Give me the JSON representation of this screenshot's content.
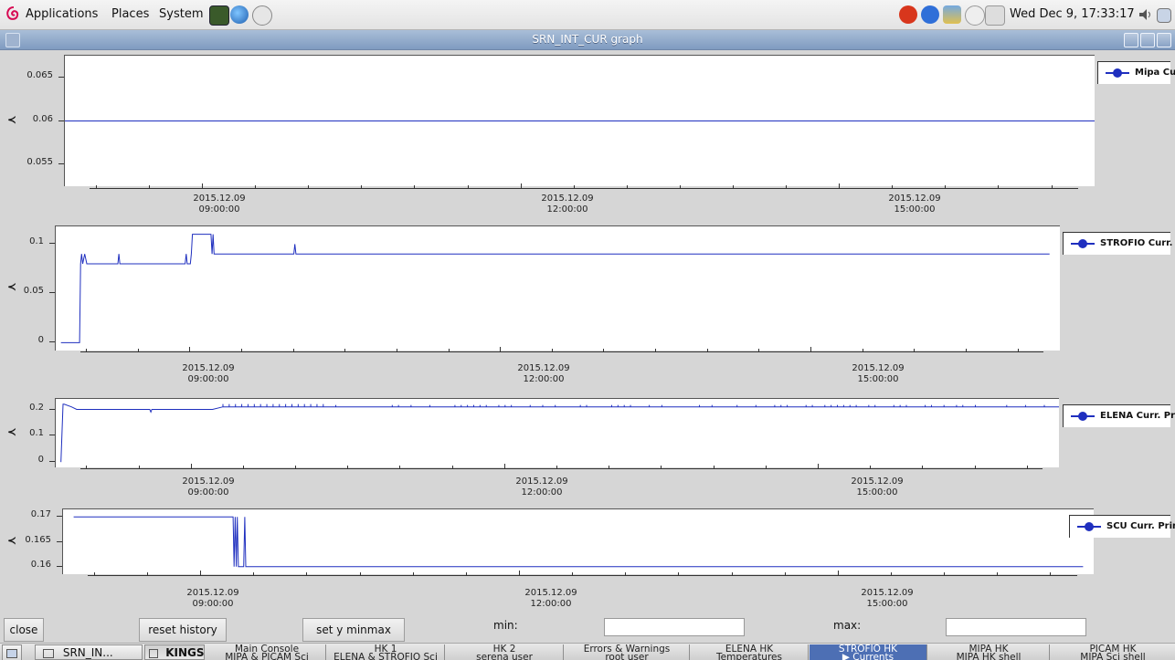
{
  "top_panel": {
    "applications": "Applications",
    "places": "Places",
    "system": "System",
    "clock": "Wed Dec  9, 17:33:17"
  },
  "window": {
    "title": "SRN_INT_CUR graph"
  },
  "colors": {
    "series": "#1f2fbf",
    "titlebar": "#8aa3c6",
    "active_workspace": "#4d6fb4"
  },
  "chart_data": [
    {
      "type": "line",
      "title": "",
      "ylabel": "A",
      "x_tick_labels": [
        {
          "date": "2015.12.09",
          "time": "09:00:00"
        },
        {
          "date": "2015.12.09",
          "time": "12:00:00"
        },
        {
          "date": "2015.12.09",
          "time": "15:00:00"
        }
      ],
      "x_hours": [
        7.7,
        17.4
      ],
      "ylim": [
        0.0525,
        0.0675
      ],
      "y_ticks": [
        "0.065",
        "0.06",
        "0.055"
      ],
      "y_tick_values": [
        0.065,
        0.06,
        0.055
      ],
      "series": [
        {
          "name": "Mipa Curr",
          "x": [
            7.7,
            17.4
          ],
          "y": [
            0.06,
            0.06
          ]
        }
      ]
    },
    {
      "type": "line",
      "title": "",
      "ylabel": "A",
      "x_tick_labels": [
        {
          "date": "2015.12.09",
          "time": "09:00:00"
        },
        {
          "date": "2015.12.09",
          "time": "12:00:00"
        },
        {
          "date": "2015.12.09",
          "time": "15:00:00"
        }
      ],
      "x_hours": [
        7.7,
        17.4
      ],
      "ylim": [
        -0.008,
        0.118
      ],
      "y_ticks": [
        "0.1",
        "0.05",
        "0"
      ],
      "y_tick_values": [
        0.1,
        0.05,
        0
      ],
      "series": [
        {
          "name": "STROFIO Curr. Pr",
          "x": [
            7.75,
            7.93,
            7.94,
            7.95,
            7.96,
            7.98,
            8.0,
            8.3,
            8.31,
            8.32,
            8.33,
            8.34,
            8.35,
            8.35,
            8.95,
            8.96,
            8.97,
            9.0,
            9.01,
            9.02,
            9.03,
            9.2,
            9.21,
            9.22,
            9.23,
            9.24,
            9.25,
            10.0,
            10.01,
            10.02,
            10.03,
            17.3
          ],
          "y": [
            0,
            0,
            0.08,
            0.09,
            0.08,
            0.09,
            0.08,
            0.08,
            0.09,
            0.08,
            0.08,
            0.08,
            0.08,
            0.08,
            0.08,
            0.09,
            0.08,
            0.08,
            0.09,
            0.11,
            0.11,
            0.11,
            0.09,
            0.11,
            0.09,
            0.09,
            0.09,
            0.09,
            0.1,
            0.09,
            0.09,
            0.09
          ]
        }
      ]
    },
    {
      "type": "line",
      "title": "",
      "ylabel": "A",
      "x_tick_labels": [
        {
          "date": "2015.12.09",
          "time": "09:00:00"
        },
        {
          "date": "2015.12.09",
          "time": "12:00:00"
        },
        {
          "date": "2015.12.09",
          "time": "15:00:00"
        }
      ],
      "x_hours": [
        7.7,
        17.3
      ],
      "ylim": [
        -0.02,
        0.24
      ],
      "y_ticks": [
        "0.2",
        "0.1",
        "0"
      ],
      "y_tick_values": [
        0.2,
        0.1,
        0
      ],
      "series": [
        {
          "name": "ELENA Curr. Prim",
          "x": [
            7.75,
            7.77,
            7.78,
            7.85,
            7.9,
            8.6,
            8.61,
            8.62,
            9.2,
            9.3,
            17.3
          ],
          "y": [
            0,
            0.22,
            0.22,
            0.21,
            0.2,
            0.2,
            0.19,
            0.2,
            0.2,
            0.21,
            0.21
          ],
          "spikes_note": ""
        }
      ]
    },
    {
      "type": "line",
      "title": "",
      "ylabel": "A",
      "x_tick_labels": [
        {
          "date": "2015.12.09",
          "time": "09:00:00"
        },
        {
          "date": "2015.12.09",
          "time": "12:00:00"
        },
        {
          "date": "2015.12.09",
          "time": "15:00:00"
        }
      ],
      "x_hours": [
        7.7,
        17.4
      ],
      "ylim": [
        0.1585,
        0.1715
      ],
      "y_ticks": [
        "0.17",
        "0.165",
        "0.16"
      ],
      "y_tick_values": [
        0.17,
        0.165,
        0.16
      ],
      "series": [
        {
          "name": "SCU Curr. Prim.",
          "x": [
            7.8,
            9.3,
            9.31,
            9.32,
            9.33,
            9.34,
            9.35,
            9.36,
            9.4,
            9.41,
            9.42,
            17.3
          ],
          "y": [
            0.17,
            0.17,
            0.16,
            0.17,
            0.16,
            0.17,
            0.16,
            0.16,
            0.16,
            0.17,
            0.16,
            0.16
          ]
        }
      ]
    }
  ],
  "controls": {
    "close": "close",
    "reset_history": "reset history",
    "set_y_minmax": "set y minmax",
    "min_label": "min:",
    "max_label": "max:",
    "min_value": "",
    "max_value": ""
  },
  "taskbar": {
    "task1": "SRN_IN...",
    "task2": "KINGS...",
    "workspaces": [
      {
        "top": "Main Console",
        "bottom": "MIPA & PICAM Sci"
      },
      {
        "top": "HK 1",
        "bottom": "ELENA & STROFIO Sci"
      },
      {
        "top": "HK 2",
        "bottom": "serena user"
      },
      {
        "top": "Errors & Warnings",
        "bottom": "root user"
      },
      {
        "top": "ELENA HK",
        "bottom": "Temperatures"
      },
      {
        "top": "STROFIO HK",
        "bottom": "Currents"
      },
      {
        "top": "MIPA HK",
        "bottom": "MIPA HK shell"
      },
      {
        "top": "PICAM HK",
        "bottom": "MIPA Sci shell"
      }
    ]
  }
}
